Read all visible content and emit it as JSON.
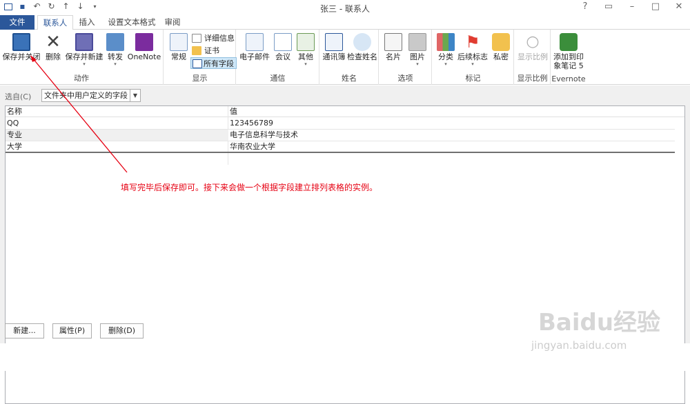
{
  "window": {
    "title": "张三 - 联系人"
  },
  "tabs": [
    "文件",
    "联系人",
    "插入",
    "设置文本格式",
    "审阅"
  ],
  "ribbon": {
    "actions": {
      "label": "动作",
      "save_close": "保存并关闭",
      "delete": "删除",
      "save_new": "保存并新建",
      "forward": "转发",
      "onenote": "OneNote"
    },
    "show": {
      "label": "显示",
      "general": "常规",
      "details": "详细信息",
      "certificates": "证书",
      "all_fields": "所有字段"
    },
    "communicate": {
      "label": "通信",
      "email": "电子邮件",
      "meeting": "会议",
      "more": "其他"
    },
    "names": {
      "label": "姓名",
      "address_book": "通讯簿",
      "check_names": "检查姓名"
    },
    "options": {
      "label": "选项",
      "business_card": "名片",
      "picture": "图片"
    },
    "tags": {
      "label": "标记",
      "categorize": "分类",
      "follow_up": "后续标志",
      "private": "私密"
    },
    "zoom": {
      "label": "显示比例",
      "zoom": "显示比例"
    },
    "evernote": {
      "label": "Evernote",
      "add_line1": "添加到印",
      "add_line2": "象笔记 5"
    }
  },
  "select_from": {
    "label": "选自(C)",
    "value": "文件夹中用户定义的字段"
  },
  "table": {
    "headers": [
      "名称",
      "值"
    ],
    "rows": [
      {
        "name": "QQ",
        "value": "123456789"
      },
      {
        "name": "专业",
        "value": "电子信息科学与技术"
      },
      {
        "name": "大学",
        "value": "华南农业大学"
      }
    ]
  },
  "buttons": {
    "new": "新建...",
    "properties": "属性(P)",
    "delete": "删除(D)"
  },
  "annotation": "填写完毕后保存即可。接下来会做一个根据字段建立排列表格的实例。",
  "watermark": {
    "line1": "Baidu经验",
    "line2": "jingyan.baidu.com"
  },
  "colors": {
    "accent": "#2b579a",
    "annotation": "#e60012"
  }
}
